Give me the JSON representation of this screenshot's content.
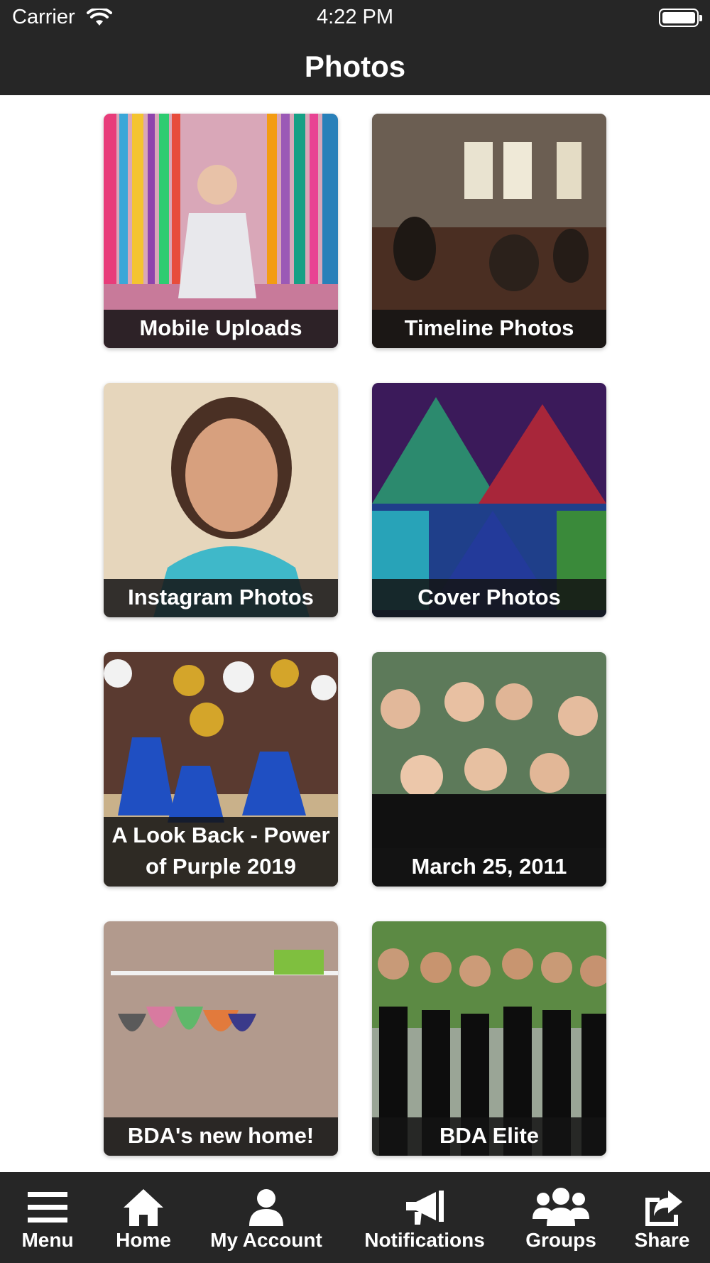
{
  "status_bar": {
    "carrier": "Carrier",
    "time": "4:22 PM"
  },
  "header": {
    "title": "Photos"
  },
  "albums": [
    {
      "label": "Mobile Uploads"
    },
    {
      "label": "Timeline Photos"
    },
    {
      "label": "Instagram Photos"
    },
    {
      "label": "Cover Photos"
    },
    {
      "label": "A Look Back - Power of Purple 2019"
    },
    {
      "label": "March 25, 2011"
    },
    {
      "label": "BDA's new home!"
    },
    {
      "label": "BDA Elite"
    }
  ],
  "tabbar": {
    "items": [
      {
        "label": "Menu",
        "icon": "menu-icon"
      },
      {
        "label": "Home",
        "icon": "home-icon"
      },
      {
        "label": "My Account",
        "icon": "user-icon"
      },
      {
        "label": "Notifications",
        "icon": "megaphone-icon"
      },
      {
        "label": "Groups",
        "icon": "groups-icon"
      },
      {
        "label": "Share",
        "icon": "share-icon"
      }
    ]
  },
  "colors": {
    "bar_background": "#262626",
    "content_background": "#ffffff",
    "caption_background": "#141414"
  }
}
